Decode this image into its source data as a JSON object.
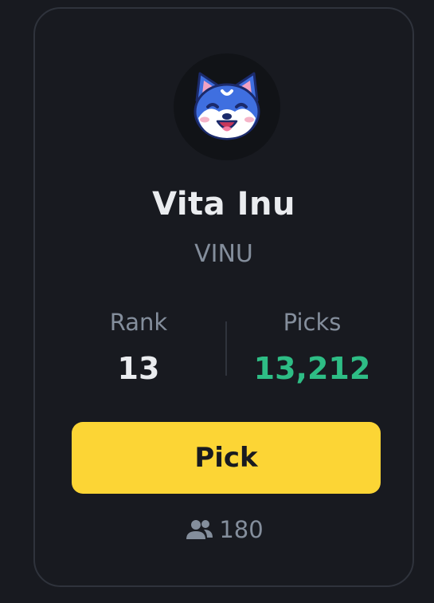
{
  "token": {
    "name": "Vita Inu",
    "symbol": "VINU",
    "logo_icon": "shiba-inu-dog-logo-icon"
  },
  "stats": {
    "rank_label": "Rank",
    "rank_value": "13",
    "picks_label": "Picks",
    "picks_value": "13,212"
  },
  "actions": {
    "pick_label": "Pick"
  },
  "participants": {
    "icon": "users-icon",
    "count": "180"
  },
  "colors": {
    "background": "#181a20",
    "accent_button": "#fcd535",
    "positive": "#2ebd85",
    "muted_text": "#848e9c",
    "primary_text": "#eaecef"
  }
}
